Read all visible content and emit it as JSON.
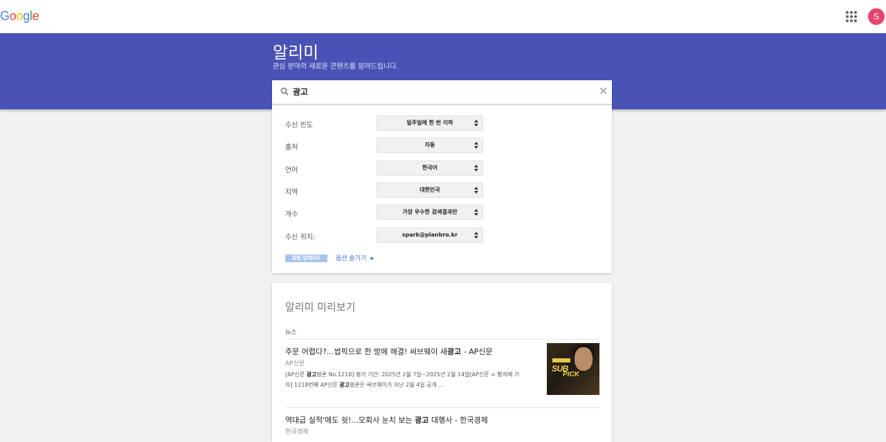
{
  "header": {
    "logo_letters": [
      {
        "char": "G",
        "color": "#4285F4"
      },
      {
        "char": "o",
        "color": "#EA4335"
      },
      {
        "char": "o",
        "color": "#FBBC05"
      },
      {
        "char": "g",
        "color": "#4285F4"
      },
      {
        "char": "l",
        "color": "#34A853"
      },
      {
        "char": "e",
        "color": "#EA4335"
      }
    ],
    "apps_icon": "apps-grid-icon",
    "avatar_letter": "S",
    "avatar_color": "#e8436b"
  },
  "banner": {
    "title": "알리미",
    "subtitle": "관심 분야의 새로운 콘텐츠를 알려드립니다.",
    "color": "#4a53b5"
  },
  "search": {
    "value": "광고",
    "clear_icon": "close-icon"
  },
  "options": [
    {
      "label": "수신 빈도",
      "value": "일주일에 한 번 이하"
    },
    {
      "label": "출처",
      "value": "자동"
    },
    {
      "label": "언어",
      "value": "한국어"
    },
    {
      "label": "지역",
      "value": "대한민국"
    },
    {
      "label": "개수",
      "value": "가장 우수한 검색결과만"
    },
    {
      "label": "수신 위치:",
      "value": "spark@planbro.kr"
    }
  ],
  "update_button": "알림 업데이트",
  "hide_options": "옵션 숨기기",
  "preview": {
    "title": "알리미 미리보기",
    "section": "뉴스",
    "articles": [
      {
        "title_pre": "주문 어렵다?...썹픽으로 한 방에 해결! 써브웨이 새",
        "title_bold": "광고",
        "title_post": " - AP신문",
        "source": "AP신문",
        "snippet_line1_pre": "[AP신문 ",
        "snippet_line1_bold": "광고",
        "snippet_line1_post": "평론 No.1218] 평가 기간: 2025년 2월 7일~2025년 2월 14일[AP신문 = 황지예 기",
        "snippet_line2_pre": "자] 1218번째 AP신문 ",
        "snippet_line2_bold": "광고",
        "snippet_line2_post": "평론은 써브웨이가 지난 2월 4일 공개 ...",
        "thumb_text_1": "SUB",
        "thumb_text_2": "PICK"
      },
      {
        "title_pre": "역대급 실적'에도 쉿!...모회사 눈치 보는 ",
        "title_bold": "광고",
        "title_post": " 대행사 - 한국경제",
        "source": "한국경제"
      }
    ]
  }
}
